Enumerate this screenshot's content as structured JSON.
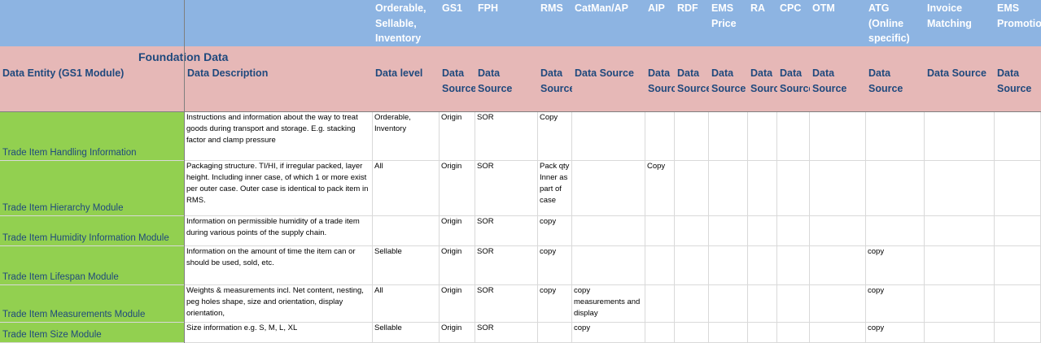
{
  "title": "Foundation Data",
  "header_top": [
    "",
    "",
    "Orderable, Sellable, Inventory",
    "GS1",
    "FPH",
    "RMS",
    "CatMan/AP",
    "AIP",
    "RDF",
    "EMS Price",
    "RA",
    "CPC",
    "OTM",
    "ATG (Online specific)",
    "Invoice Matching",
    "EMS Promotion"
  ],
  "header_sub": [
    "Data Entity (GS1 Module)",
    "Data Description",
    "Data level",
    "Data Source",
    "Data Source",
    "Data Source",
    "Data Source",
    "Data Source",
    "Data Source",
    "Data Source",
    "Data Source",
    "Data Source",
    "Data Source",
    "Data Source",
    "Data Source",
    "Data Source"
  ],
  "rows": [
    [
      "Trade Item Handling Information",
      "Instructions and information about the way to treat goods during transport and storage. E.g. stacking factor and clamp pressure",
      "Orderable, Inventory",
      "Origin",
      "SOR",
      "Copy",
      "",
      "",
      "",
      "",
      "",
      "",
      "",
      "",
      "",
      ""
    ],
    [
      "Trade Item Hierarchy Module",
      "Packaging structure. TI/HI, if irregular packed, layer height. Including inner case, of which 1 or more exist per outer case. Outer case is identical to pack item in RMS.",
      "All",
      "Origin",
      "SOR",
      "Pack qty Inner as part of case",
      "",
      "Copy",
      "",
      "",
      "",
      "",
      "",
      "",
      "",
      ""
    ],
    [
      "Trade Item Humidity Information Module",
      "Information on permissible humidity of a trade item during various points of the supply chain.",
      "",
      "Origin",
      "SOR",
      "copy",
      "",
      "",
      "",
      "",
      "",
      "",
      "",
      "",
      "",
      ""
    ],
    [
      "Trade Item Lifespan Module",
      "Information on the amount of time the item can or should be used, sold, etc.",
      "Sellable",
      "Origin",
      "SOR",
      "copy",
      "",
      "",
      "",
      "",
      "",
      "",
      "",
      "copy",
      "",
      ""
    ],
    [
      "Trade Item Measurements Module",
      "Weights & measurements incl. Net content, nesting, peg holes shape, size and orientation, display orientation,",
      "All",
      "Origin",
      "SOR",
      "copy",
      "copy measurements and display",
      "",
      "",
      "",
      "",
      "",
      "",
      "copy",
      "",
      ""
    ],
    [
      "Trade Item Size Module",
      "Size information e.g. S, M, L, XL",
      "Sellable",
      "Origin",
      "SOR",
      "",
      "copy",
      "",
      "",
      "",
      "",
      "",
      "",
      "copy",
      "",
      ""
    ]
  ]
}
